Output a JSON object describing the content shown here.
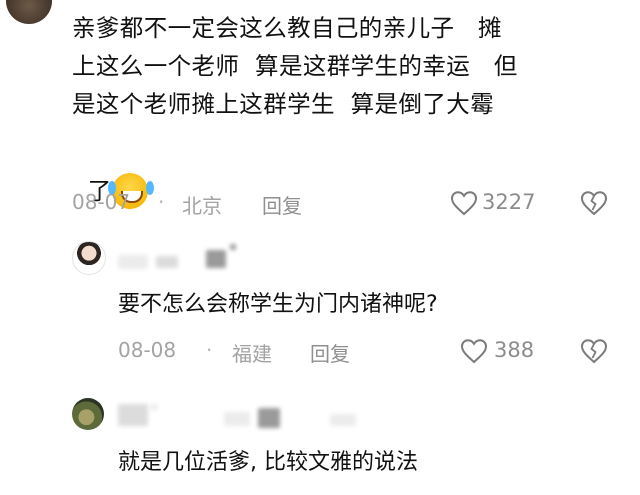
{
  "comment": {
    "lines": [
      "亲爹都不一定会这么教自己的亲儿子   摊",
      "上这么一个老师  算是这群学生的幸运   但",
      "是这个老师摊上这群学生  算是倒了大霉",
      "了"
    ],
    "emoji": "laughing-tears-emoji",
    "date": "08-07",
    "location": "北京",
    "reply_label": "回复",
    "likes": "3227"
  },
  "replies": [
    {
      "text": "要不怎么会称学生为门内诸神呢?",
      "date": "08-08",
      "location": "福建",
      "reply_label": "回复",
      "likes": "388"
    },
    {
      "text": "就是几位活爹, 比较文雅的说法"
    }
  ],
  "meta_separator": "·",
  "colors": {
    "text": "#111111",
    "meta": "#a3a3a3",
    "icon": "#7a7a7a"
  }
}
